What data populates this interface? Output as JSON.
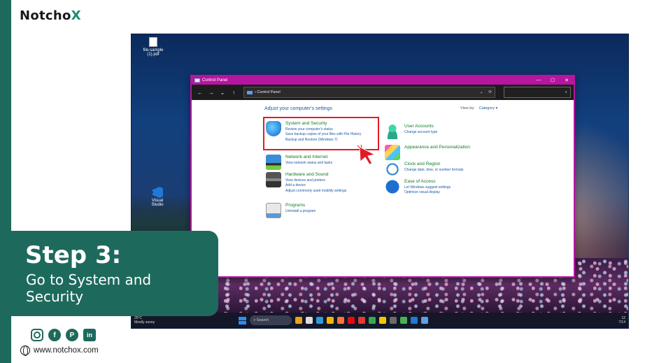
{
  "brand": {
    "logo_prefix": "Notcho",
    "logo_x": "X"
  },
  "step": {
    "title": "Step 3:",
    "description": "Go to System and Security"
  },
  "website": "www.notchox.com",
  "socials": [
    "instagram-icon",
    "facebook-icon",
    "pinterest-icon",
    "linkedin-icon"
  ],
  "desktop": {
    "icons": [
      {
        "label": "file-sample (1).pdf"
      },
      {
        "label": "Visual Studio"
      }
    ]
  },
  "window": {
    "title": "Control Panel",
    "controls": {
      "minimize": "—",
      "maximize": "☐",
      "close": "✕"
    },
    "address": "Control Panel",
    "heading": "Adjust your computer's settings",
    "view_by_label": "View by:",
    "view_by_value": "Category ▾",
    "categories": [
      {
        "title": "System and Security",
        "links": [
          "Review your computer's status",
          "Save backup copies of your files with File History",
          "Backup and Restore (Windows 7)"
        ]
      },
      {
        "title": "Network and Internet",
        "links": [
          "View network status and tasks"
        ]
      },
      {
        "title": "Hardware and Sound",
        "links": [
          "View devices and printers",
          "Add a device",
          "Adjust commonly used mobility settings"
        ]
      },
      {
        "title": "Programs",
        "links": [
          "Uninstall a program"
        ]
      },
      {
        "title": "User Accounts",
        "links": [
          "Change account type"
        ]
      },
      {
        "title": "Appearance and Personalization",
        "links": []
      },
      {
        "title": "Clock and Region",
        "links": [
          "Change date, time, or number formats"
        ]
      },
      {
        "title": "Ease of Access",
        "links": [
          "Let Windows suggest settings",
          "Optimize visual display"
        ]
      }
    ]
  },
  "taskbar": {
    "weather_temp": "26°C",
    "weather_desc": "Mostly sunny",
    "search_placeholder": "Search",
    "time": "12",
    "date": "7/14"
  },
  "colors": {
    "brand_green": "#1d6a5c",
    "window_border": "#b5159f",
    "highlight": "#e01b24",
    "category_title": "#0f7a23",
    "link": "#1a5aa5"
  }
}
